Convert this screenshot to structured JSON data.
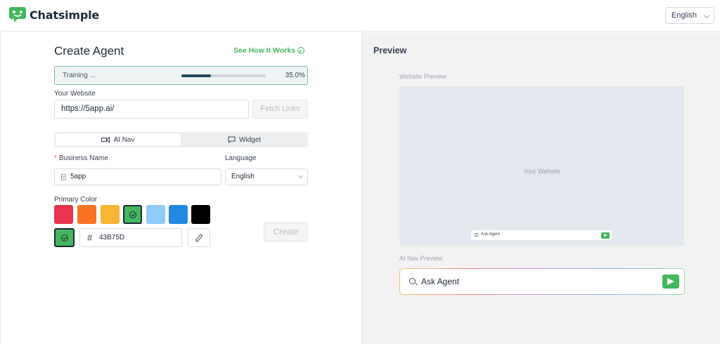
{
  "app": {
    "name": "Chatsimple",
    "language_selector": "English"
  },
  "form": {
    "title": "Create Agent",
    "see_how_link": "See How It Works",
    "training": {
      "label": "Training ...",
      "percent_text": "35.0%",
      "progress": 0.35
    },
    "website": {
      "label": "Your Website",
      "value": "https://5app.ai/",
      "fetch_button": "Fetch Links"
    },
    "tabs": [
      {
        "label": "AI Nav",
        "active": true
      },
      {
        "label": "Widget",
        "active": false
      }
    ],
    "business_name": {
      "label": "Business Name",
      "required_mark": "*",
      "value": "5app"
    },
    "language": {
      "label": "Language",
      "value": "English"
    },
    "primary_color": {
      "label": "Primary Color",
      "swatches": [
        "#e8344e",
        "#fa7325",
        "#f8b433",
        "#43b75d",
        "#90caf9",
        "#2389e0",
        "#000000"
      ],
      "selected_index": 3,
      "current": "#43b75d",
      "hash": "#",
      "hex_value": "43B75D"
    },
    "create_button": "Create"
  },
  "preview": {
    "title": "Preview",
    "website_preview_label": "Website Preview",
    "website_placeholder": "Your Website",
    "mini_bar_text": "Ask Agent",
    "ai_nav_preview_label": "AI Nav Preview",
    "ai_nav_text": "Ask Agent"
  }
}
